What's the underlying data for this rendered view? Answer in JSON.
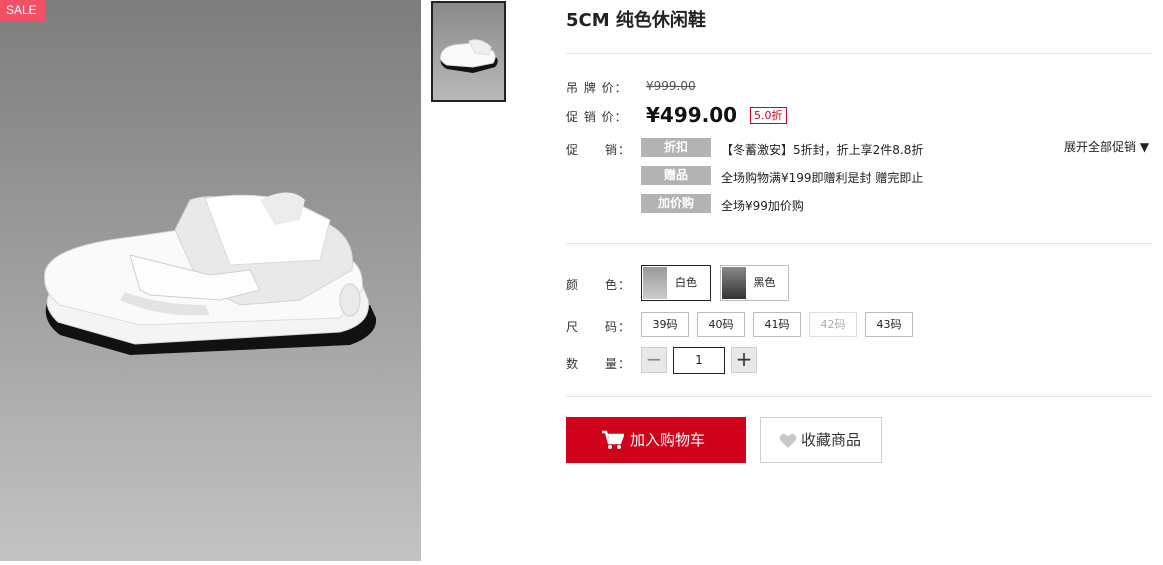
{
  "badge": {
    "sale": "SALE"
  },
  "product": {
    "title": "5CM 纯色休闲鞋"
  },
  "price": {
    "tag_label": "吊 牌 价：",
    "tag_value": "¥999.00",
    "promo_label": "促 销 价：",
    "promo_value": "¥499.00",
    "discount": "5.0折"
  },
  "promotions": {
    "label": "促　　销：",
    "expand": "展开全部促销",
    "items": [
      {
        "tag": "折扣",
        "text": "【冬蓄激安】5折封，折上享2件8.8折"
      },
      {
        "tag": "赠品",
        "text": "全场购物满¥199即赠利是封 赠完即止"
      },
      {
        "tag": "加价购",
        "text": "全场¥99加价购"
      }
    ]
  },
  "color": {
    "label": "颜　　色：",
    "options": [
      {
        "label": "白色",
        "selected": true
      },
      {
        "label": "黑色",
        "selected": false
      }
    ]
  },
  "size": {
    "label": "尺　　码：",
    "options": [
      {
        "label": "39码",
        "available": true
      },
      {
        "label": "40码",
        "available": true
      },
      {
        "label": "41码",
        "available": true
      },
      {
        "label": "42码",
        "available": false
      },
      {
        "label": "43码",
        "available": true
      }
    ]
  },
  "quantity": {
    "label": "数　　量：",
    "minus": "−",
    "value": "1",
    "plus": "+"
  },
  "actions": {
    "add_to_cart": "加入购物车",
    "favorite": "收藏商品"
  },
  "colors": {
    "accent": "#d0021b",
    "sale_badge": "#f25064",
    "promo_tag": "#b3b3b3"
  }
}
